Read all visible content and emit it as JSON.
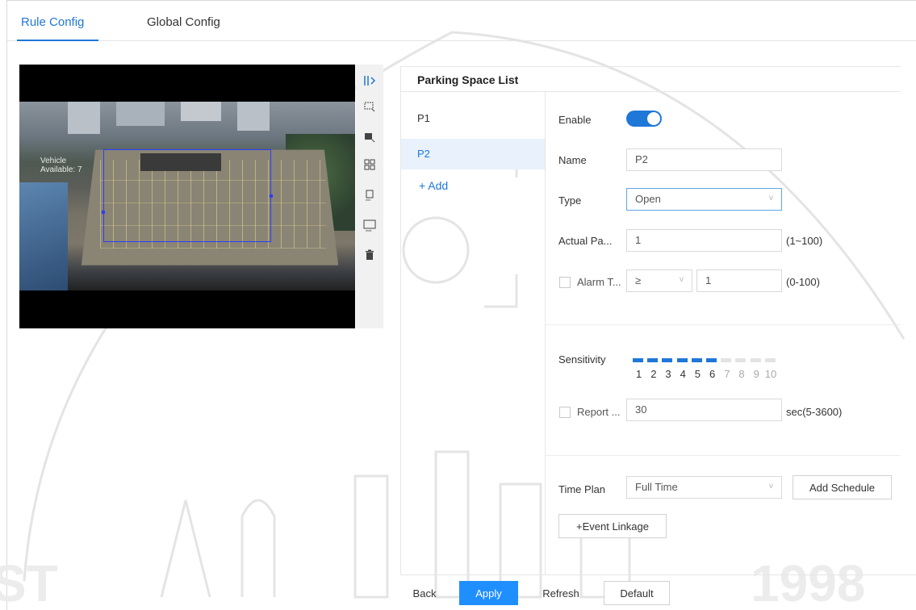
{
  "tabs": [
    {
      "label": "Rule Config",
      "active": true
    },
    {
      "label": "Global Config",
      "active": false
    }
  ],
  "video": {
    "overlay_line1": "Vehicle",
    "overlay_line2": "Available: 7"
  },
  "toolbar_icons": [
    "draw-area-icon",
    "draw-rectangle-icon",
    "edit-area-icon",
    "grid-icon",
    "min-size-icon",
    "max-size-icon",
    "delete-icon"
  ],
  "parking_list": {
    "title": "Parking Space List",
    "items": [
      "P1",
      "P2"
    ],
    "selected": "P2",
    "add_label": "+ Add"
  },
  "form": {
    "enable_label": "Enable",
    "enable_on": true,
    "name_label": "Name",
    "name_value": "P2",
    "type_label": "Type",
    "type_value": "Open",
    "actual_label": "Actual Pa...",
    "actual_value": "1",
    "actual_hint": "(1~100)",
    "alarm_label": "Alarm T...",
    "alarm_op": "≥",
    "alarm_value": "1",
    "alarm_hint": "(0-100)",
    "sensitivity_label": "Sensitivity",
    "sensitivity_level": 6,
    "sensitivity_scale": [
      "1",
      "2",
      "3",
      "4",
      "5",
      "6",
      "7",
      "8",
      "9",
      "10"
    ],
    "report_label": "Report ...",
    "report_value": "30",
    "report_hint": "sec(5-3600)",
    "time_plan_label": "Time Plan",
    "time_plan_value": "Full Time",
    "add_schedule": "Add Schedule",
    "event_linkage": "+Event Linkage"
  },
  "footer": {
    "back": "Back",
    "apply": "Apply",
    "refresh": "Refresh",
    "default": "Default"
  },
  "colors": {
    "accent": "#1f77d8",
    "primary_button": "#1f8fff",
    "zone": "#2b3dff"
  }
}
